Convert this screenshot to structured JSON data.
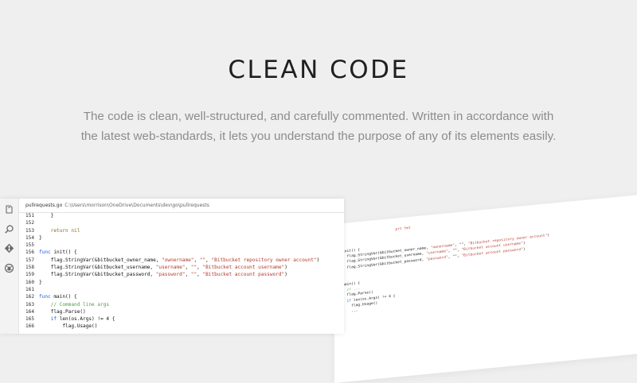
{
  "hero": {
    "title": "CLEAN CODE",
    "description": "The code is clean, well-structured, and carefully commented. Written in accordance with the latest web-standards, it lets you understand the purpose of any of its elements easily."
  },
  "editor": {
    "file_name": "pullrequests.go",
    "file_path": "C:\\Users\\morrison\\OneDrive\\Documents\\dev\\go\\pullrequests",
    "activity_icons": [
      "files-icon",
      "search-icon",
      "git-icon",
      "debug-icon"
    ],
    "lines": [
      {
        "n": "151",
        "tokens": [
          {
            "t": "    }",
            "c": "code-text"
          }
        ]
      },
      {
        "n": "152",
        "tokens": []
      },
      {
        "n": "153",
        "tokens": [
          {
            "t": "    return nil",
            "c": "ret"
          }
        ]
      },
      {
        "n": "154",
        "tokens": [
          {
            "t": "}",
            "c": "code-text"
          }
        ]
      },
      {
        "n": "155",
        "tokens": []
      },
      {
        "n": "156",
        "tokens": [
          {
            "t": "func ",
            "c": "kw"
          },
          {
            "t": "init() {",
            "c": "fn"
          }
        ]
      },
      {
        "n": "157",
        "tokens": [
          {
            "t": "    flag.StringVar(&bitbucket_owner_name, ",
            "c": "fn"
          },
          {
            "t": "\"ownername\"",
            "c": "str"
          },
          {
            "t": ", ",
            "c": "fn"
          },
          {
            "t": "\"\"",
            "c": "str"
          },
          {
            "t": ", ",
            "c": "fn"
          },
          {
            "t": "\"Bitbucket repository owner account\"",
            "c": "str"
          },
          {
            "t": ")",
            "c": "fn"
          }
        ]
      },
      {
        "n": "158",
        "tokens": [
          {
            "t": "    flag.StringVar(&bitbucket_username, ",
            "c": "fn"
          },
          {
            "t": "\"username\"",
            "c": "str"
          },
          {
            "t": ", ",
            "c": "fn"
          },
          {
            "t": "\"\"",
            "c": "str"
          },
          {
            "t": ", ",
            "c": "fn"
          },
          {
            "t": "\"Bitbucket account username\"",
            "c": "str"
          },
          {
            "t": ")",
            "c": "fn"
          }
        ]
      },
      {
        "n": "159",
        "tokens": [
          {
            "t": "    flag.StringVar(&bitbucket_password, ",
            "c": "fn"
          },
          {
            "t": "\"password\"",
            "c": "str"
          },
          {
            "t": ", ",
            "c": "fn"
          },
          {
            "t": "\"\"",
            "c": "str"
          },
          {
            "t": ", ",
            "c": "fn"
          },
          {
            "t": "\"Bitbucket account password\"",
            "c": "str"
          },
          {
            "t": ")",
            "c": "fn"
          }
        ]
      },
      {
        "n": "160",
        "tokens": [
          {
            "t": "}",
            "c": "code-text"
          }
        ]
      },
      {
        "n": "161",
        "tokens": []
      },
      {
        "n": "162",
        "tokens": [
          {
            "t": "func ",
            "c": "kw"
          },
          {
            "t": "main() {",
            "c": "fn"
          }
        ]
      },
      {
        "n": "163",
        "tokens": [
          {
            "t": "    // Command line args",
            "c": "cm"
          }
        ]
      },
      {
        "n": "164",
        "tokens": [
          {
            "t": "    flag.Parse()",
            "c": "fn"
          }
        ]
      },
      {
        "n": "165",
        "tokens": [
          {
            "t": "    ",
            "c": "fn"
          },
          {
            "t": "if ",
            "c": "kw"
          },
          {
            "t": "len(os.Args) != 4 {",
            "c": "fn"
          }
        ]
      },
      {
        "n": "166",
        "tokens": [
          {
            "t": "        flag.Usage()",
            "c": "fn"
          }
        ]
      }
    ]
  },
  "back_panel": {
    "lines": [
      [
        {
          "t": "                        ",
          "c": "b-fn"
        },
        {
          "t": "prt fmt",
          "c": "b-str"
        }
      ],
      [
        {
          "t": "",
          "c": "b-fn"
        }
      ],
      [
        {
          "t": "",
          "c": "b-fn"
        }
      ],
      [
        {
          "t": "init() {",
          "c": "b-fn"
        }
      ],
      [
        {
          "t": "  flag.StringVar(&bitbucket_owner_name, ",
          "c": "b-fn"
        },
        {
          "t": "\"ownername\"",
          "c": "b-str"
        },
        {
          "t": ", \"\", ",
          "c": "b-fn"
        },
        {
          "t": "\"Bitbucket repository owner account\"",
          "c": "b-str"
        },
        {
          "t": ")",
          "c": "b-fn"
        }
      ],
      [
        {
          "t": "  flag.StringVar(&bitbucket_username, ",
          "c": "b-fn"
        },
        {
          "t": "\"username\"",
          "c": "b-str"
        },
        {
          "t": ", \"\", ",
          "c": "b-fn"
        },
        {
          "t": "\"Bitbucket account username\"",
          "c": "b-str"
        },
        {
          "t": ")",
          "c": "b-fn"
        }
      ],
      [
        {
          "t": "  flag.StringVar(&bitbucket_password, ",
          "c": "b-fn"
        },
        {
          "t": "\"password\"",
          "c": "b-str"
        },
        {
          "t": ", \"\", ",
          "c": "b-fn"
        },
        {
          "t": "\"Bitbucket account password\"",
          "c": "b-str"
        },
        {
          "t": ")",
          "c": "b-fn"
        }
      ],
      [
        {
          "t": "",
          "c": "b-fn"
        }
      ],
      [
        {
          "t": "",
          "c": "b-fn"
        }
      ],
      [
        {
          "t": "main() {",
          "c": "b-fn"
        }
      ],
      [
        {
          "t": "  // ...",
          "c": "b-cm"
        }
      ],
      [
        {
          "t": "  flag.Parse()",
          "c": "b-fn"
        }
      ],
      [
        {
          "t": "  if ",
          "c": "b-kw"
        },
        {
          "t": "len(os.Args) != 4 {",
          "c": "b-fn"
        }
      ],
      [
        {
          "t": "    flag.Usage()",
          "c": "b-fn"
        }
      ],
      [
        {
          "t": "    ...",
          "c": "b-fn"
        }
      ]
    ]
  },
  "colors": {
    "background": "#efefef",
    "title": "#1f1f1f",
    "description": "#8c8c8c",
    "keyword": "#1f5fd6",
    "string": "#b23b2e",
    "comment": "#4f9e4a"
  }
}
